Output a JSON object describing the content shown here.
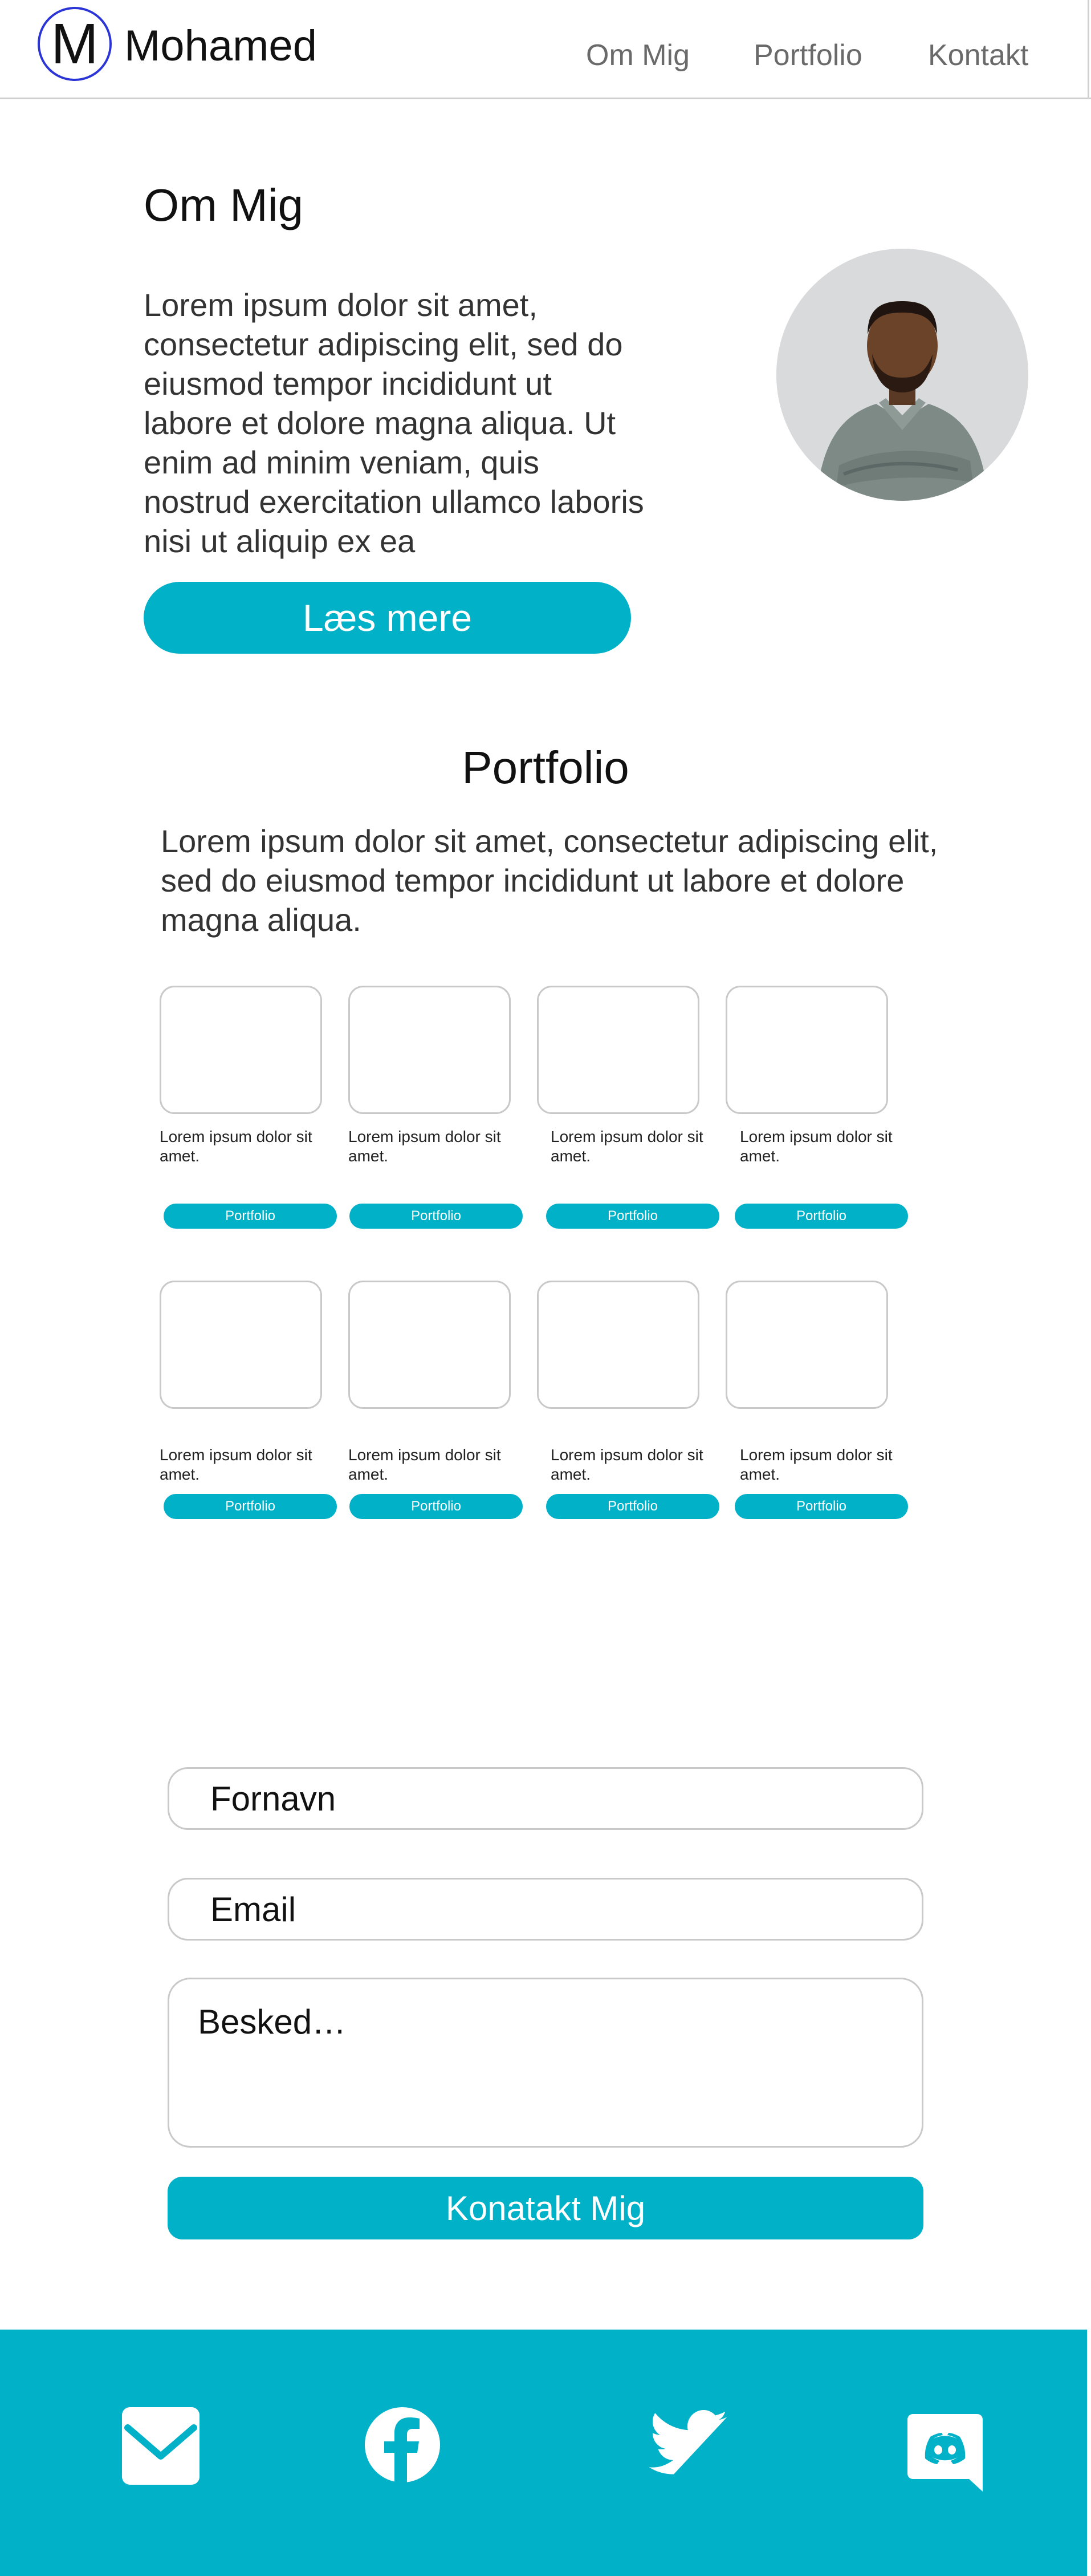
{
  "brand": {
    "logo_letter": "M",
    "name": "Mohamed"
  },
  "nav": [
    {
      "label": "Om Mig"
    },
    {
      "label": "Portfolio"
    },
    {
      "label": "Kontakt"
    }
  ],
  "about": {
    "title": "Om Mig",
    "text": "Lorem ipsum dolor sit amet, consectetur adipiscing elit, sed do eiusmod tempor incididunt ut labore et dolore magna aliqua. Ut enim ad minim veniam, quis nostrud exercitation ullamco laboris nisi ut aliquip ex ea",
    "button_label": "Læs mere"
  },
  "portfolio": {
    "title": "Portfolio",
    "text": "Lorem ipsum dolor sit amet, consectetur adipiscing elit, sed do eiusmod tempor incididunt ut labore et dolore magna aliqua.",
    "cards": [
      {
        "caption": "Lorem ipsum dolor sit amet.",
        "button": "Portfolio"
      },
      {
        "caption": "Lorem ipsum dolor sit amet.",
        "button": "Portfolio"
      },
      {
        "caption": "Lorem ipsum dolor sit amet.",
        "button": "Portfolio"
      },
      {
        "caption": "Lorem ipsum dolor sit amet.",
        "button": "Portfolio"
      },
      {
        "caption": "Lorem ipsum dolor sit amet.",
        "button": "Portfolio"
      },
      {
        "caption": "Lorem ipsum dolor sit amet.",
        "button": "Portfolio"
      },
      {
        "caption": "Lorem ipsum dolor sit amet.",
        "button": "Portfolio"
      },
      {
        "caption": "Lorem ipsum dolor sit amet.",
        "button": "Portfolio"
      }
    ]
  },
  "contact": {
    "firstname_placeholder": "Fornavn",
    "email_placeholder": "Email",
    "message_placeholder": "Besked…",
    "submit_label": "Konatakt Mig"
  },
  "footer": {
    "icons": [
      "mail-icon",
      "facebook-icon",
      "twitter-icon",
      "discord-icon"
    ]
  },
  "colors": {
    "accent": "#00b1c8",
    "logo_ring": "#2b35d6",
    "border": "#c9c9c9"
  }
}
